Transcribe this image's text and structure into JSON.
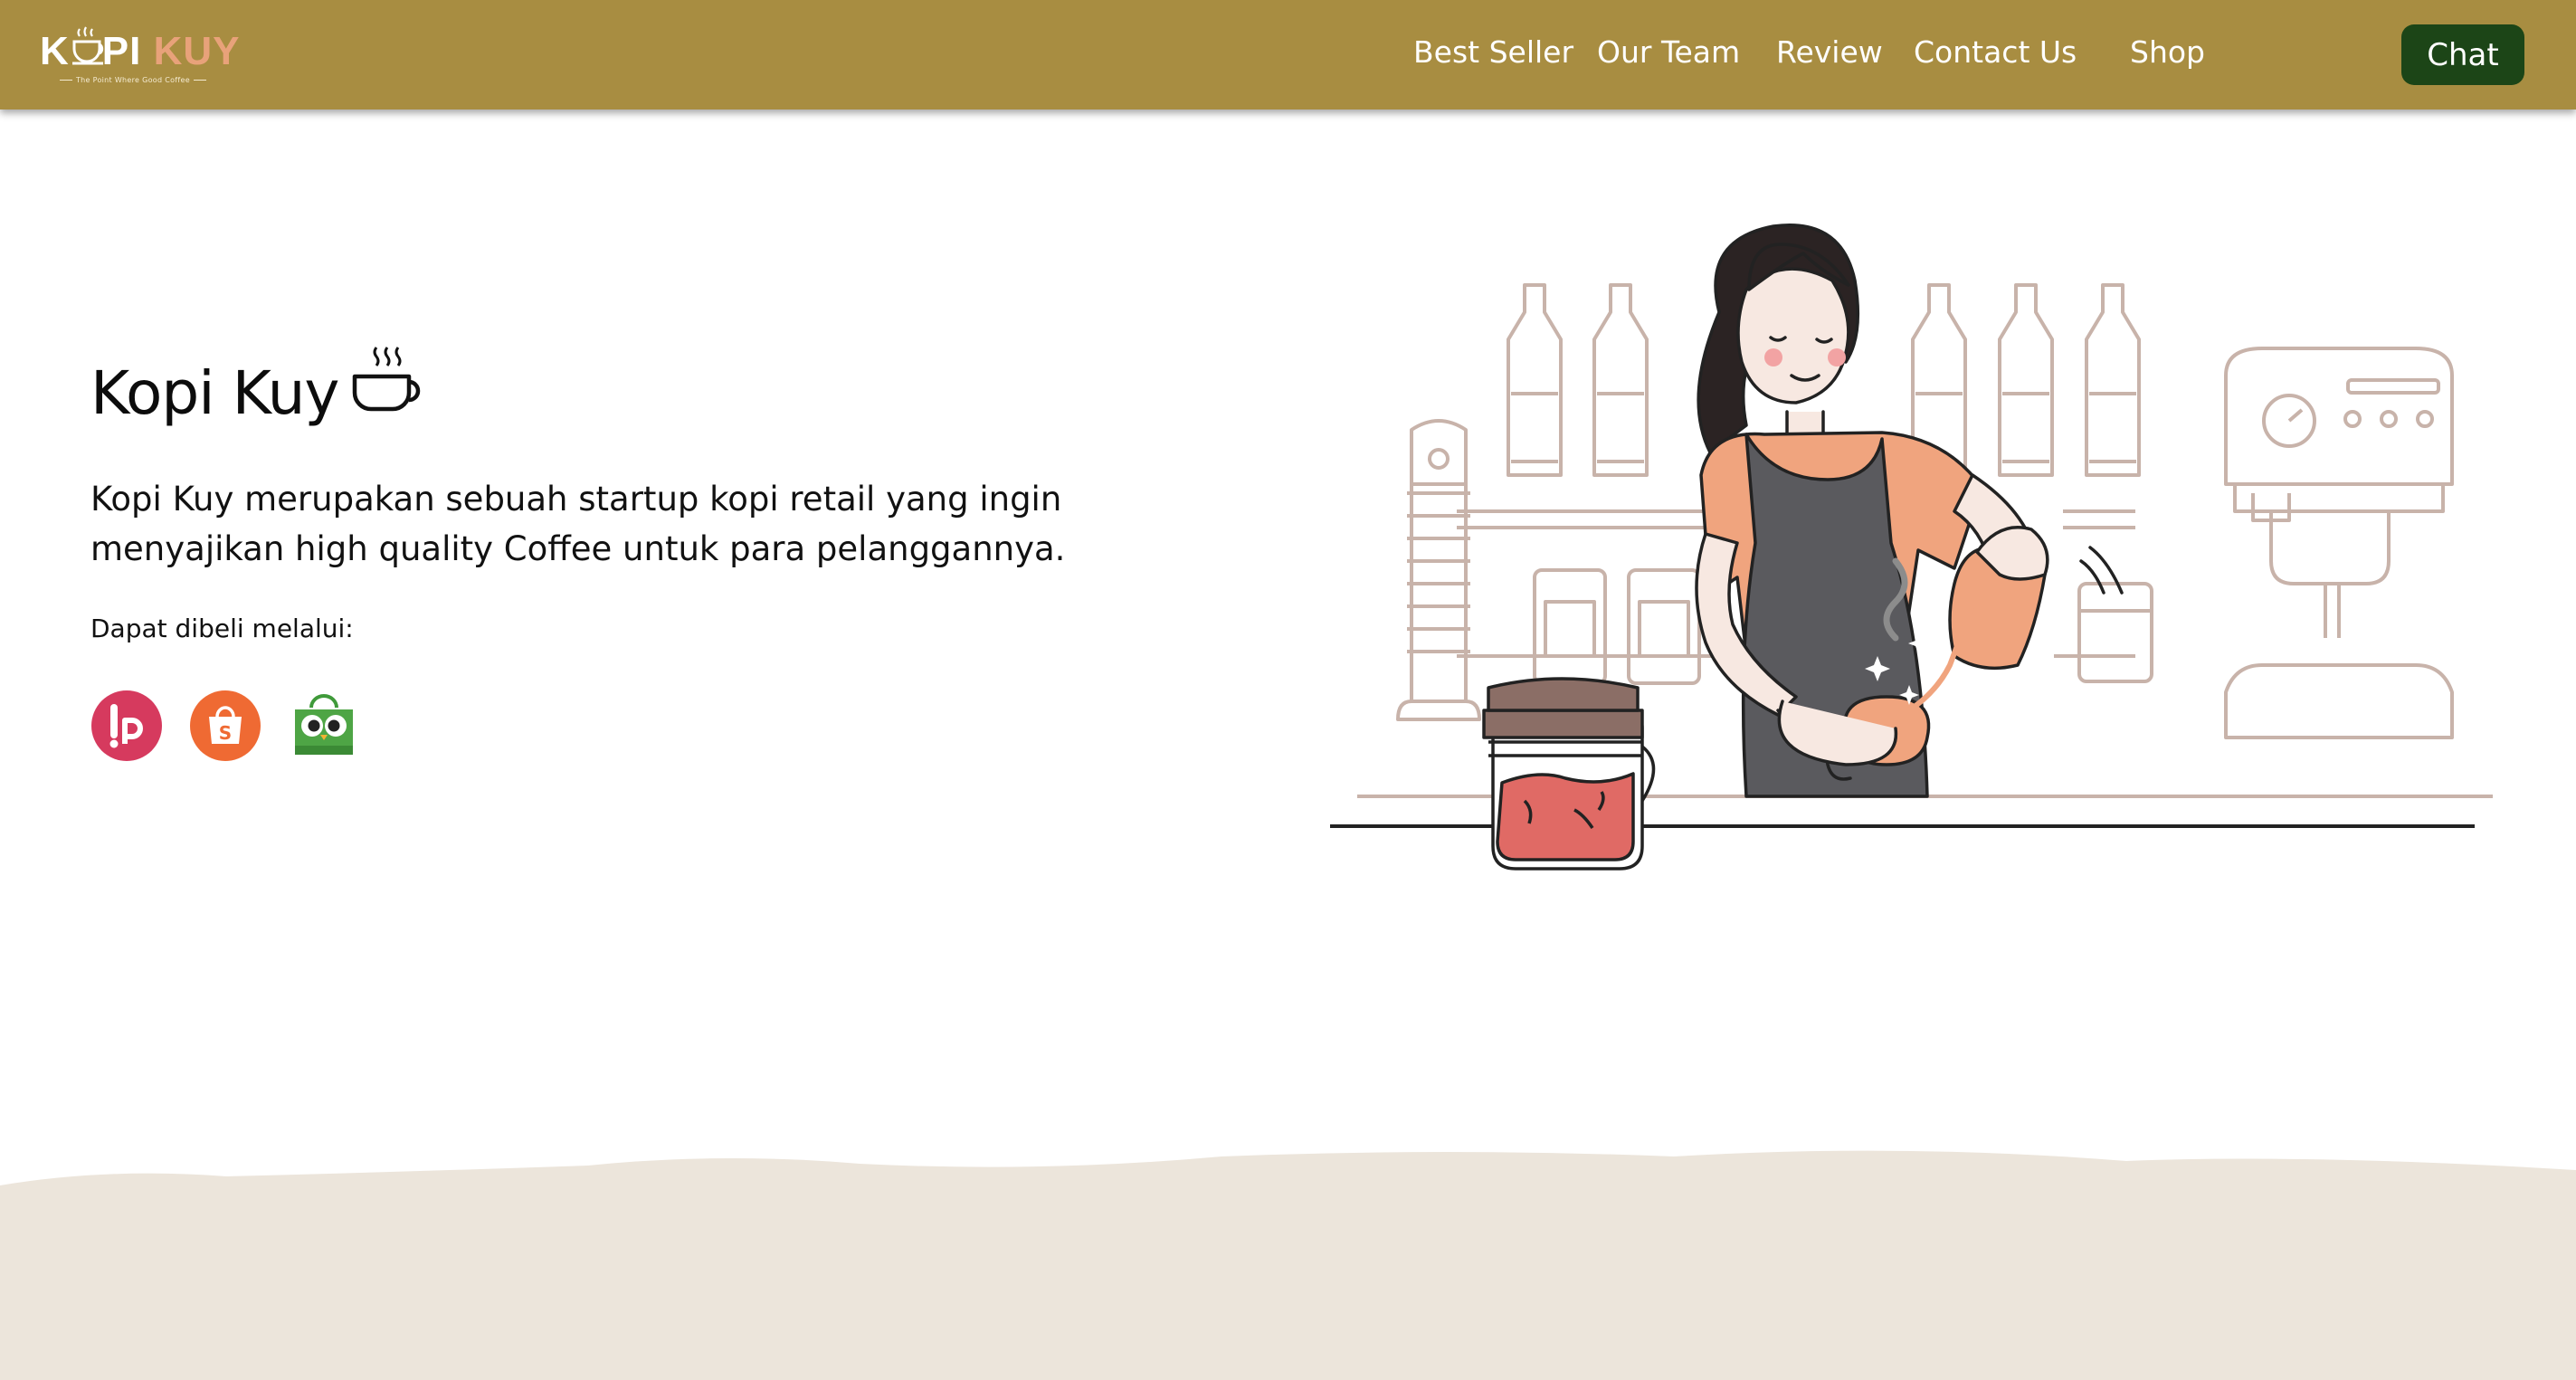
{
  "nav": {
    "logo_k": "K",
    "logo_pi": "PI",
    "logo_kuy": "KUY",
    "logo_tagline": "The Point Where Good Coffee",
    "links": [
      "Best Seller",
      "Our Team",
      "Review",
      "Contact Us",
      "Shop"
    ],
    "chat_label": "Chat"
  },
  "hero": {
    "title": "Kopi Kuy",
    "description": "Kopi Kuy merupakan sebuah startup kopi retail yang ingin menyajikan high quality Coffee untuk para pelanggannya.",
    "buy_label": "Dapat dibeli melalui:",
    "stores": [
      {
        "name": "blibli",
        "icon": "blibli-icon"
      },
      {
        "name": "shopee",
        "icon": "shopee-icon"
      },
      {
        "name": "tokopedia",
        "icon": "tokopedia-icon"
      }
    ]
  },
  "colors": {
    "navbar": "#a88d41",
    "chat_button": "#1c4517",
    "logo_accent": "#e8a27a",
    "bottom_band": "#ece5db",
    "apron": "#5a5a5e",
    "shirt": "#f0a47e",
    "line_art": "#c8b3aa"
  }
}
